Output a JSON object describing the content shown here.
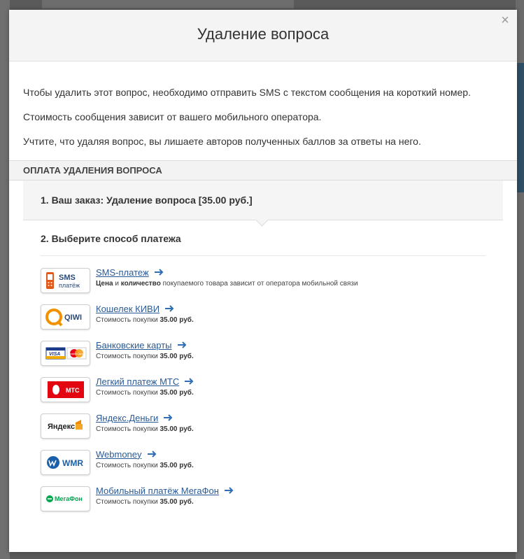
{
  "modal": {
    "title": "Удаление вопроса",
    "close_glyph": "×"
  },
  "intro": [
    "Чтобы удалить этот вопрос, необходимо отправить SMS с текстом сообщения на короткий номер.",
    "Стоимость сообщения зависит от вашего мобильного оператора.",
    "Учтите, что удаляя вопрос, вы лишаете авторов полученных баллов за ответы на него."
  ],
  "payment": {
    "section_title": "ОПЛАТА УДАЛЕНИЯ ВОПРОСА",
    "order_label": "1. Ваш заказ: Удаление вопроса [35.00 руб.]",
    "choose_label": "2. Выберите способ платежа",
    "methods": [
      {
        "name": "SMS-платеж",
        "logo": "sms-logo",
        "desc_pre": "",
        "desc_b1": "Цена",
        "desc_mid": " и ",
        "desc_b2": "количество",
        "desc_post": " покупаемого товара зависит от оператора мобильной связи",
        "logo_text1": "SMS",
        "logo_text2": "платёж"
      },
      {
        "name": "Кошелек КИВИ",
        "logo": "qiwi-logo",
        "desc_pre": "Стоимость покупки ",
        "price": "35.00 руб.",
        "logo_text1": "QIWI"
      },
      {
        "name": "Банковские карты",
        "logo": "cards-logo",
        "desc_pre": "Стоимость покупки ",
        "price": "35.00 руб.",
        "logo_text1": "VISA",
        "logo_text2": "MasterCard"
      },
      {
        "name": "Легкий платеж МТС",
        "logo": "mts-logo",
        "desc_pre": "Стоимость покупки ",
        "price": "35.00 руб.",
        "logo_text1": "МТС"
      },
      {
        "name": "Яндекс.Деньги",
        "logo": "yandex-logo",
        "desc_pre": "Стоимость покупки ",
        "price": "35.00 руб.",
        "logo_text1": "Яндекс"
      },
      {
        "name": "Webmoney",
        "logo": "wmr-logo",
        "desc_pre": "Стоимость покупки ",
        "price": "35.00 руб.",
        "logo_text1": "WMR"
      },
      {
        "name": "Мобильный платёж МегаФон",
        "logo": "megafon-logo",
        "desc_pre": "Стоимость покупки ",
        "price": "35.00 руб.",
        "logo_text1": "МегаФон"
      }
    ]
  },
  "colors": {
    "link": "#2a5a96",
    "arrow": "#2f6db5",
    "sms_orange": "#e25a1a",
    "qiwi_orange": "#f39200",
    "mts_red": "#e30611",
    "yandex_orange": "#f08a00",
    "wmr_blue": "#1b5fa8",
    "megafon_green": "#00a650"
  }
}
